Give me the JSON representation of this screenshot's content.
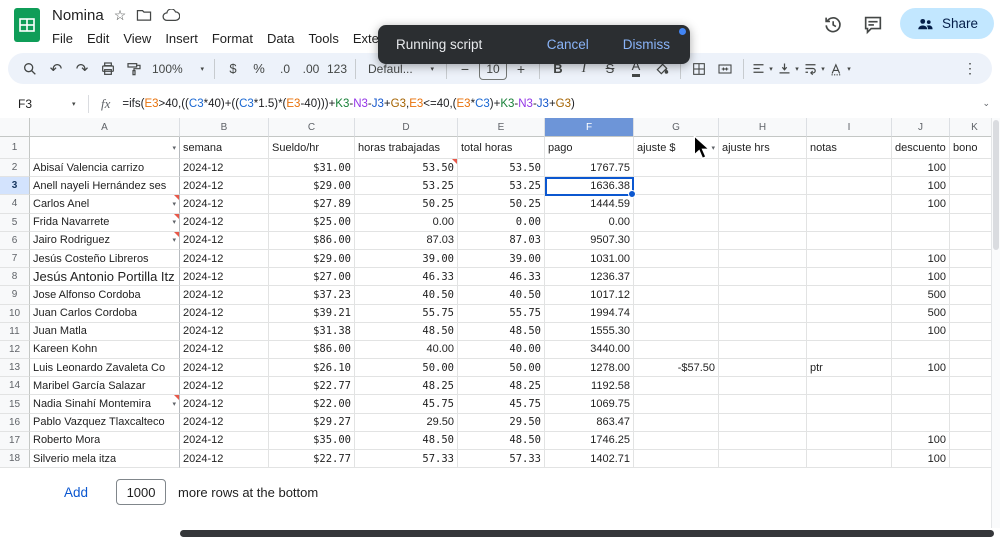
{
  "header": {
    "title": "Nomina",
    "menus": [
      "File",
      "Edit",
      "View",
      "Insert",
      "Format",
      "Data",
      "Tools",
      "Extensions"
    ],
    "share": "Share"
  },
  "icons": {
    "star": "☆",
    "undo": "↶",
    "redo": "↷",
    "caret": "▾",
    "more_vertical": "⋮",
    "chevron_down": "⌄"
  },
  "toast": {
    "message": "Running script",
    "cancel": "Cancel",
    "dismiss": "Dismiss"
  },
  "toolbar": {
    "zoom": "100%",
    "currency": "$",
    "percent": "%",
    "dec_dec": ".0",
    "inc_dec": ".00",
    "more_formats": "123",
    "font": "Defaul...",
    "minus": "−",
    "font_size": "10",
    "plus": "+",
    "bold": "B",
    "italic": "I",
    "strike": "S",
    "text_color": "A"
  },
  "formula_bar": {
    "cell_ref": "F3",
    "fx_label": "fx",
    "formula_tokens": [
      {
        "t": "=ifs(",
        "c": "#202124"
      },
      {
        "t": "E3",
        "c": "#e8710a"
      },
      {
        "t": ">40,((",
        "c": "#202124"
      },
      {
        "t": "C3",
        "c": "#1967d2"
      },
      {
        "t": "*40)+((",
        "c": "#202124"
      },
      {
        "t": "C3",
        "c": "#1967d2"
      },
      {
        "t": "*1.5)*(",
        "c": "#202124"
      },
      {
        "t": "E3",
        "c": "#e8710a"
      },
      {
        "t": "-40)))+",
        "c": "#202124"
      },
      {
        "t": "K3",
        "c": "#188038"
      },
      {
        "t": "-",
        "c": "#202124"
      },
      {
        "t": "N3",
        "c": "#9334e6"
      },
      {
        "t": "-",
        "c": "#202124"
      },
      {
        "t": "J3",
        "c": "#1155cc"
      },
      {
        "t": "+",
        "c": "#202124"
      },
      {
        "t": "G3",
        "c": "#a56300"
      },
      {
        "t": ",",
        "c": "#202124"
      },
      {
        "t": "E3",
        "c": "#e8710a"
      },
      {
        "t": "<=40,(",
        "c": "#202124"
      },
      {
        "t": "E3",
        "c": "#e8710a"
      },
      {
        "t": "*",
        "c": "#202124"
      },
      {
        "t": "C3",
        "c": "#1967d2"
      },
      {
        "t": ")+",
        "c": "#202124"
      },
      {
        "t": "K3",
        "c": "#188038"
      },
      {
        "t": "-",
        "c": "#202124"
      },
      {
        "t": "N3",
        "c": "#9334e6"
      },
      {
        "t": "-",
        "c": "#202124"
      },
      {
        "t": "J3",
        "c": "#1155cc"
      },
      {
        "t": "+",
        "c": "#202124"
      },
      {
        "t": "G3",
        "c": "#a56300"
      },
      {
        "t": ")",
        "c": "#202124"
      }
    ]
  },
  "sheet": {
    "col_letters": [
      "A",
      "B",
      "C",
      "D",
      "E",
      "F",
      "G",
      "H",
      "I",
      "J",
      "K"
    ],
    "active_col": "F",
    "active_row_number": 3,
    "header_cells": [
      "",
      "semana",
      "Sueldo/hr",
      "horas trabajadas",
      "total horas",
      "pago",
      "ajuste $",
      "ajuste hrs",
      "notas",
      "descuento",
      "bono"
    ],
    "rows": [
      {
        "n": 2,
        "cells": [
          "Abisaí Valencia carrizo",
          "2024-12",
          "$31.00",
          "53.50",
          "53.50",
          "1767.75",
          "",
          "",
          "",
          "100",
          ""
        ],
        "d_note": true
      },
      {
        "n": 3,
        "cells": [
          "Anell nayeli Hernández ses",
          "2024-12",
          "$29.00",
          "53.25",
          "53.25",
          "1636.38",
          "",
          "",
          "",
          "100",
          ""
        ]
      },
      {
        "n": 4,
        "cells": [
          "Carlos Anel",
          "2024-12",
          "$27.89",
          "50.25",
          "50.25",
          "1444.59",
          "",
          "",
          "",
          "100",
          ""
        ],
        "has_dropdown": true,
        "has_note": true
      },
      {
        "n": 5,
        "cells": [
          "Frida Navarrete",
          "2024-12",
          "$25.00",
          "0.00",
          "0.00",
          "0.00",
          "",
          "",
          "",
          "",
          ""
        ],
        "has_dropdown": true,
        "has_note": true,
        "d_plain": true
      },
      {
        "n": 6,
        "cells": [
          "Jairo Rodriguez",
          "2024-12",
          "$86.00",
          "87.03",
          "87.03",
          "9507.30",
          "",
          "",
          "",
          "",
          ""
        ],
        "has_dropdown": true,
        "has_note": true,
        "d_plain": true
      },
      {
        "n": 7,
        "cells": [
          "Jesús Costeño Libreros",
          "2024-12",
          "$29.00",
          "39.00",
          "39.00",
          "1031.00",
          "",
          "",
          "",
          "100",
          ""
        ]
      },
      {
        "n": 8,
        "cells": [
          "Jesús Antonio Portilla Itz",
          "2024-12",
          "$27.00",
          "46.33",
          "46.33",
          "1236.37",
          "",
          "",
          "",
          "100",
          ""
        ],
        "name_large": true
      },
      {
        "n": 9,
        "cells": [
          "Jose Alfonso Cordoba",
          "2024-12",
          "$37.23",
          "40.50",
          "40.50",
          "1017.12",
          "",
          "",
          "",
          "500",
          ""
        ]
      },
      {
        "n": 10,
        "cells": [
          "Juan Carlos Cordoba",
          "2024-12",
          "$39.21",
          "55.75",
          "55.75",
          "1994.74",
          "",
          "",
          "",
          "500",
          ""
        ]
      },
      {
        "n": 11,
        "cells": [
          "Juan Matla",
          "2024-12",
          "$31.38",
          "48.50",
          "48.50",
          "1555.30",
          "",
          "",
          "",
          "100",
          ""
        ]
      },
      {
        "n": 12,
        "cells": [
          "Kareen Kohn",
          "2024-12",
          "$86.00",
          "40.00",
          "40.00",
          "3440.00",
          "",
          "",
          "",
          "",
          ""
        ],
        "d_plain": true
      },
      {
        "n": 13,
        "cells": [
          "Luis Leonardo Zavaleta Co",
          "2024-12",
          "$26.10",
          "50.00",
          "50.00",
          "1278.00",
          "-$57.50",
          "",
          "ptr",
          "100",
          ""
        ]
      },
      {
        "n": 14,
        "cells": [
          "Maribel García Salazar",
          "2024-12",
          "$22.77",
          "48.25",
          "48.25",
          "1192.58",
          "",
          "",
          "",
          "",
          ""
        ]
      },
      {
        "n": 15,
        "cells": [
          "Nadia Sinahí Montemira",
          "2024-12",
          "$22.00",
          "45.75",
          "45.75",
          "1069.75",
          "",
          "",
          "",
          "",
          ""
        ],
        "has_dropdown": true,
        "has_note": true
      },
      {
        "n": 16,
        "cells": [
          "Pablo Vazquez Tlaxcalteco",
          "2024-12",
          "$29.27",
          "29.50",
          "29.50",
          "863.47",
          "",
          "",
          "",
          "",
          ""
        ],
        "d_plain": true
      },
      {
        "n": 17,
        "cells": [
          "Roberto Mora",
          "2024-12",
          "$35.00",
          "48.50",
          "48.50",
          "1746.25",
          "",
          "",
          "",
          "100",
          ""
        ]
      },
      {
        "n": 18,
        "cells": [
          "Silverio mela itza",
          "2024-12",
          "$22.77",
          "57.33",
          "57.33",
          "1402.71",
          "",
          "",
          "",
          "100",
          ""
        ]
      }
    ]
  },
  "footer": {
    "add_label": "Add",
    "row_count_value": "1000",
    "suffix_label": "more rows at the bottom"
  },
  "colors": {
    "accent": "#0b57d0",
    "share_bg": "#c2e7ff",
    "toast_bg": "#2b2e31",
    "toast_action": "#8ab4f8",
    "note_red": "#e8594a",
    "logo_green": "#0f9d58"
  }
}
